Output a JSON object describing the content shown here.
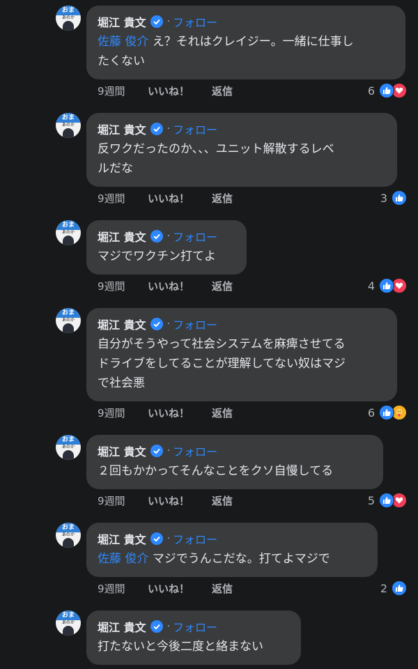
{
  "comments": [
    {
      "author": "堀江 貴文",
      "follow": "フォロー",
      "mention": "佐藤 俊介",
      "text_lines": [
        "え？それはクレイジー。一緒に仕事し",
        "たくない"
      ],
      "time": "9週間",
      "like": "いいね！",
      "reply": "返信",
      "reaction_count": "6",
      "reactions": [
        "like-icon",
        "love-icon"
      ]
    },
    {
      "author": "堀江 貴文",
      "follow": "フォロー",
      "mention": "",
      "text_lines": [
        "反ワクだったのか、、、ユニット解散するレベ",
        "ルだな"
      ],
      "time": "9週間",
      "like": "いいね！",
      "reply": "返信",
      "reaction_count": "3",
      "reactions": [
        "like-icon"
      ]
    },
    {
      "author": "堀江 貴文",
      "follow": "フォロー",
      "mention": "",
      "text_lines": [
        "マジでワクチン打てよ"
      ],
      "time": "9週間",
      "like": "いいね！",
      "reply": "返信",
      "reaction_count": "4",
      "reactions": [
        "like-icon",
        "love-icon"
      ]
    },
    {
      "author": "堀江 貴文",
      "follow": "フォロー",
      "mention": "",
      "text_lines": [
        "自分がそうやって社会システムを麻痺させてる",
        "ドライブをしてることが理解してない奴はマジ",
        "で社会悪"
      ],
      "time": "9週間",
      "like": "いいね！",
      "reply": "返信",
      "reaction_count": "6",
      "reactions": [
        "like-icon",
        "care-icon"
      ]
    },
    {
      "author": "堀江 貴文",
      "follow": "フォロー",
      "mention": "",
      "text_lines": [
        "２回もかかってそんなことをクソ自慢してる"
      ],
      "time": "9週間",
      "like": "いいね！",
      "reply": "返信",
      "reaction_count": "5",
      "reactions": [
        "like-icon",
        "love-icon"
      ]
    },
    {
      "author": "堀江 貴文",
      "follow": "フォロー",
      "mention": "佐藤 俊介",
      "text_lines": [
        "マジでうんこだな。打てよマジで"
      ],
      "time": "9週間",
      "like": "いいね！",
      "reply": "返信",
      "reaction_count": "2",
      "reactions": [
        "like-icon"
      ]
    },
    {
      "author": "堀江 貴文",
      "follow": "フォロー",
      "mention": "",
      "text_lines": [
        "打たないと今後二度と絡まない"
      ],
      "time": "",
      "like": "",
      "reply": "",
      "reaction_count": "",
      "reactions": []
    }
  ],
  "avatar": {
    "top_text": "おま",
    "sub_text": "あのか"
  },
  "colors": {
    "background": "#18191a",
    "bubble": "#3a3b3c",
    "link": "#2d88ff",
    "like": "#2d88ff",
    "love": "#f33e58"
  }
}
